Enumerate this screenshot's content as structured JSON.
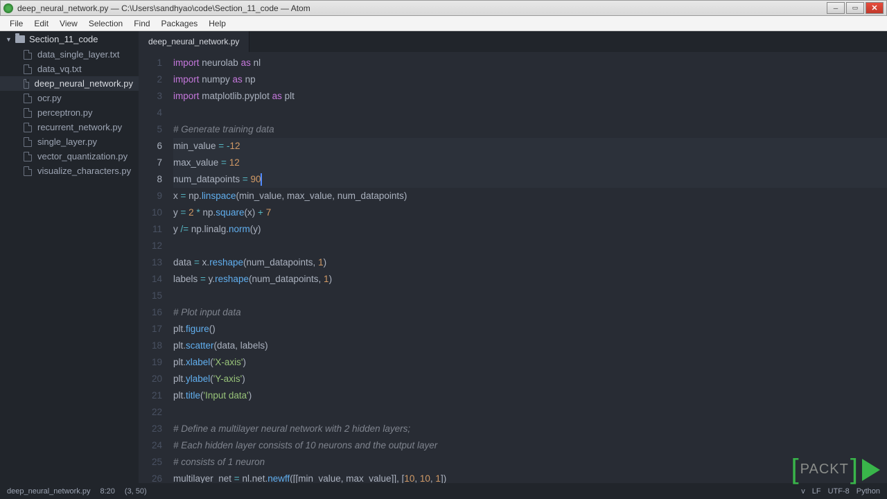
{
  "title": "deep_neural_network.py — C:\\Users\\sandhyao\\code\\Section_11_code — Atom",
  "menu": [
    "File",
    "Edit",
    "View",
    "Selection",
    "Find",
    "Packages",
    "Help"
  ],
  "sidebar": {
    "folder": "Section_11_code",
    "files": [
      {
        "name": "data_single_layer.txt"
      },
      {
        "name": "data_vq.txt"
      },
      {
        "name": "deep_neural_network.py",
        "active": true
      },
      {
        "name": "ocr.py"
      },
      {
        "name": "perceptron.py"
      },
      {
        "name": "recurrent_network.py"
      },
      {
        "name": "single_layer.py"
      },
      {
        "name": "vector_quantization.py"
      },
      {
        "name": "visualize_characters.py"
      }
    ]
  },
  "tab": "deep_neural_network.py",
  "code_lines": [
    {
      "n": 1,
      "t": [
        [
          "kw",
          "import"
        ],
        [
          "",
          " neurolab "
        ],
        [
          "as",
          "as"
        ],
        [
          "",
          " nl"
        ]
      ]
    },
    {
      "n": 2,
      "t": [
        [
          "kw",
          "import"
        ],
        [
          "",
          " numpy "
        ],
        [
          "as",
          "as"
        ],
        [
          "",
          " np"
        ]
      ]
    },
    {
      "n": 3,
      "t": [
        [
          "kw",
          "import"
        ],
        [
          "",
          " matplotlib.pyplot "
        ],
        [
          "as",
          "as"
        ],
        [
          "",
          " plt"
        ]
      ]
    },
    {
      "n": 4,
      "t": []
    },
    {
      "n": 5,
      "t": [
        [
          "cm",
          "# Generate training data"
        ]
      ]
    },
    {
      "n": 6,
      "hl": true,
      "t": [
        [
          "",
          "min_value "
        ],
        [
          "op",
          "="
        ],
        [
          "",
          " "
        ],
        [
          "op",
          "-"
        ],
        [
          "num",
          "12"
        ]
      ]
    },
    {
      "n": 7,
      "hl": true,
      "t": [
        [
          "",
          "max_value "
        ],
        [
          "op",
          "="
        ],
        [
          "",
          " "
        ],
        [
          "num",
          "12"
        ]
      ]
    },
    {
      "n": 8,
      "hl": true,
      "cursor": true,
      "t": [
        [
          "",
          "num_datapoints "
        ],
        [
          "op",
          "="
        ],
        [
          "",
          " "
        ],
        [
          "num",
          "90"
        ]
      ]
    },
    {
      "n": 9,
      "t": [
        [
          "",
          "x "
        ],
        [
          "op",
          "="
        ],
        [
          "",
          " np."
        ],
        [
          "fn",
          "linspace"
        ],
        [
          "",
          "(min_value, max_value, num_datapoints)"
        ]
      ]
    },
    {
      "n": 10,
      "t": [
        [
          "",
          "y "
        ],
        [
          "op",
          "="
        ],
        [
          "",
          " "
        ],
        [
          "num",
          "2"
        ],
        [
          "",
          " "
        ],
        [
          "op",
          "*"
        ],
        [
          "",
          " np."
        ],
        [
          "fn",
          "square"
        ],
        [
          "",
          "(x) "
        ],
        [
          "op",
          "+"
        ],
        [
          "",
          " "
        ],
        [
          "num",
          "7"
        ]
      ]
    },
    {
      "n": 11,
      "t": [
        [
          "",
          "y "
        ],
        [
          "op",
          "/="
        ],
        [
          "",
          " np.linalg."
        ],
        [
          "fn",
          "norm"
        ],
        [
          "",
          "(y)"
        ]
      ]
    },
    {
      "n": 12,
      "t": []
    },
    {
      "n": 13,
      "t": [
        [
          "",
          "data "
        ],
        [
          "op",
          "="
        ],
        [
          "",
          " x."
        ],
        [
          "fn",
          "reshape"
        ],
        [
          "",
          "(num_datapoints, "
        ],
        [
          "num",
          "1"
        ],
        [
          "",
          ")"
        ]
      ]
    },
    {
      "n": 14,
      "t": [
        [
          "",
          "labels "
        ],
        [
          "op",
          "="
        ],
        [
          "",
          " y."
        ],
        [
          "fn",
          "reshape"
        ],
        [
          "",
          "(num_datapoints, "
        ],
        [
          "num",
          "1"
        ],
        [
          "",
          ")"
        ]
      ]
    },
    {
      "n": 15,
      "t": []
    },
    {
      "n": 16,
      "t": [
        [
          "cm",
          "# Plot input data"
        ]
      ]
    },
    {
      "n": 17,
      "t": [
        [
          "",
          "plt."
        ],
        [
          "fn",
          "figure"
        ],
        [
          "",
          "()"
        ]
      ]
    },
    {
      "n": 18,
      "t": [
        [
          "",
          "plt."
        ],
        [
          "fn",
          "scatter"
        ],
        [
          "",
          "(data, labels)"
        ]
      ]
    },
    {
      "n": 19,
      "t": [
        [
          "",
          "plt."
        ],
        [
          "fn",
          "xlabel"
        ],
        [
          "",
          "("
        ],
        [
          "str",
          "'X-axis'"
        ],
        [
          "",
          ")"
        ]
      ]
    },
    {
      "n": 20,
      "t": [
        [
          "",
          "plt."
        ],
        [
          "fn",
          "ylabel"
        ],
        [
          "",
          "("
        ],
        [
          "str",
          "'Y-axis'"
        ],
        [
          "",
          ")"
        ]
      ]
    },
    {
      "n": 21,
      "t": [
        [
          "",
          "plt."
        ],
        [
          "fn",
          "title"
        ],
        [
          "",
          "("
        ],
        [
          "str",
          "'Input data'"
        ],
        [
          "",
          ")"
        ]
      ]
    },
    {
      "n": 22,
      "t": []
    },
    {
      "n": 23,
      "t": [
        [
          "cm",
          "# Define a multilayer neural network with 2 hidden layers;"
        ]
      ]
    },
    {
      "n": 24,
      "t": [
        [
          "cm",
          "# Each hidden layer consists of 10 neurons and the output layer"
        ]
      ]
    },
    {
      "n": 25,
      "t": [
        [
          "cm",
          "# consists of 1 neuron"
        ]
      ]
    },
    {
      "n": 26,
      "t": [
        [
          "",
          "multilayer_net "
        ],
        [
          "op",
          "="
        ],
        [
          "",
          " nl.net."
        ],
        [
          "fn",
          "newff"
        ],
        [
          "",
          "([[min_value, max_value]], ["
        ],
        [
          "num",
          "10"
        ],
        [
          "",
          ", "
        ],
        [
          "num",
          "10"
        ],
        [
          "",
          ", "
        ],
        [
          "num",
          "1"
        ],
        [
          "",
          "])"
        ]
      ]
    }
  ],
  "status": {
    "file": "deep_neural_network.py",
    "pos": "8:20",
    "sel": "(3, 50)",
    "right": [
      "v",
      "LF",
      "UTF-8",
      "Python"
    ]
  },
  "packt": "PACKT"
}
